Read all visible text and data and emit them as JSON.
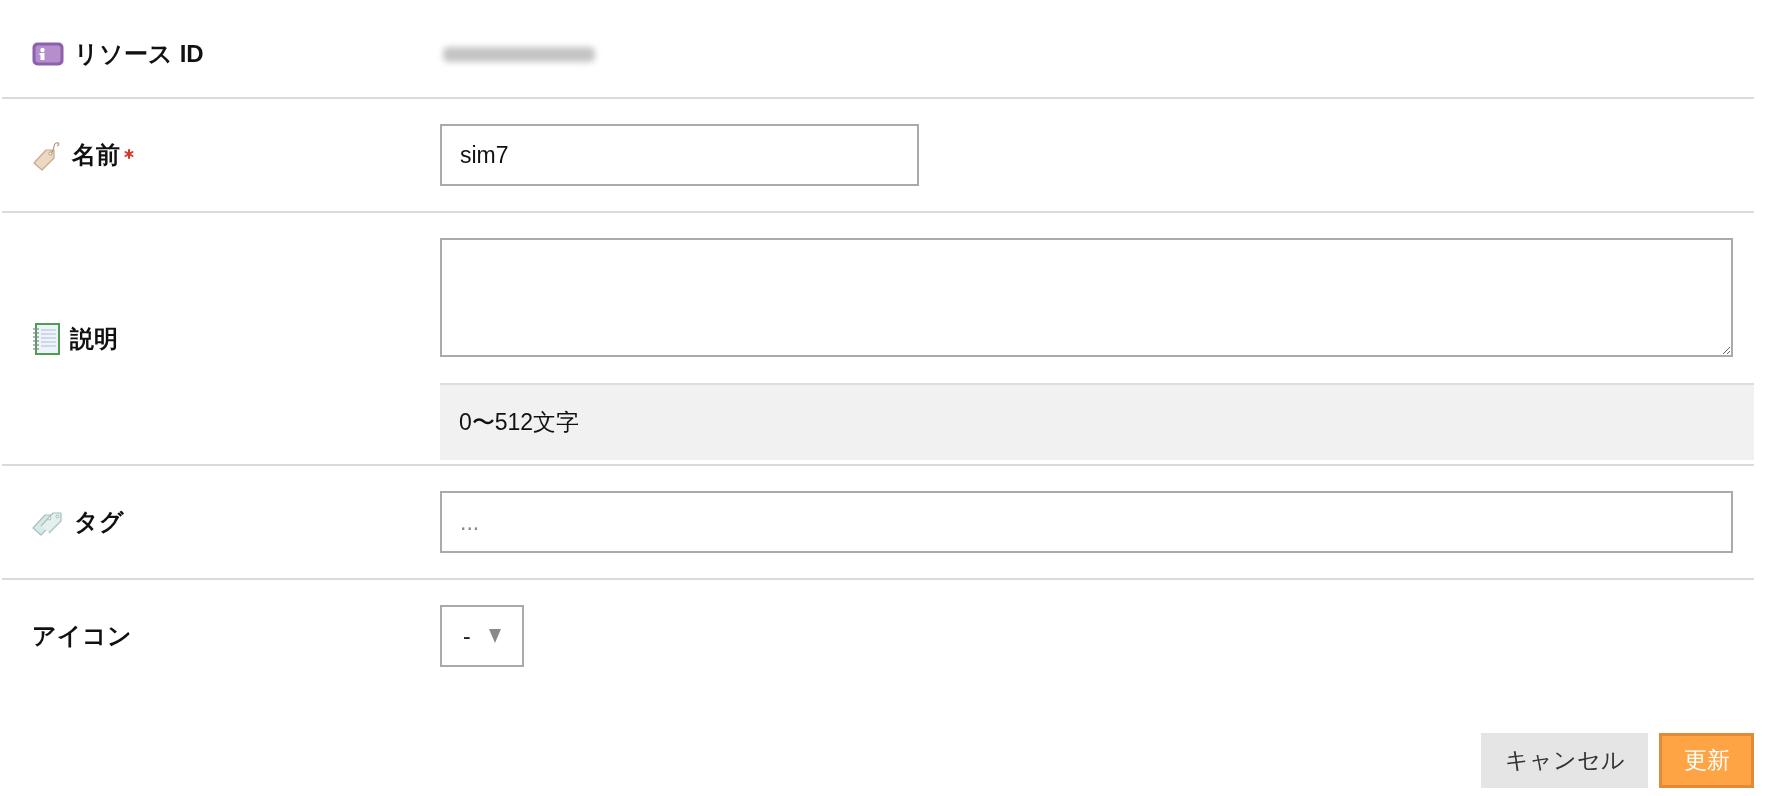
{
  "form": {
    "fields": [
      {
        "kind": "resource_id",
        "label": "リソース ID",
        "required": false,
        "blurred": true
      },
      {
        "kind": "name",
        "label": "名前",
        "required": true,
        "value": "sim7"
      },
      {
        "kind": "description",
        "label": "説明",
        "required": false,
        "hint": "0〜512文字"
      },
      {
        "kind": "tags",
        "label": "タグ",
        "required": false,
        "placeholder": "..."
      },
      {
        "kind": "icon",
        "label": "アイコン",
        "required": false,
        "value": "-"
      }
    ]
  },
  "buttons": [
    {
      "label": "キャンセル",
      "kind": "secondary"
    },
    {
      "label": "更新",
      "kind": "primary"
    }
  ]
}
